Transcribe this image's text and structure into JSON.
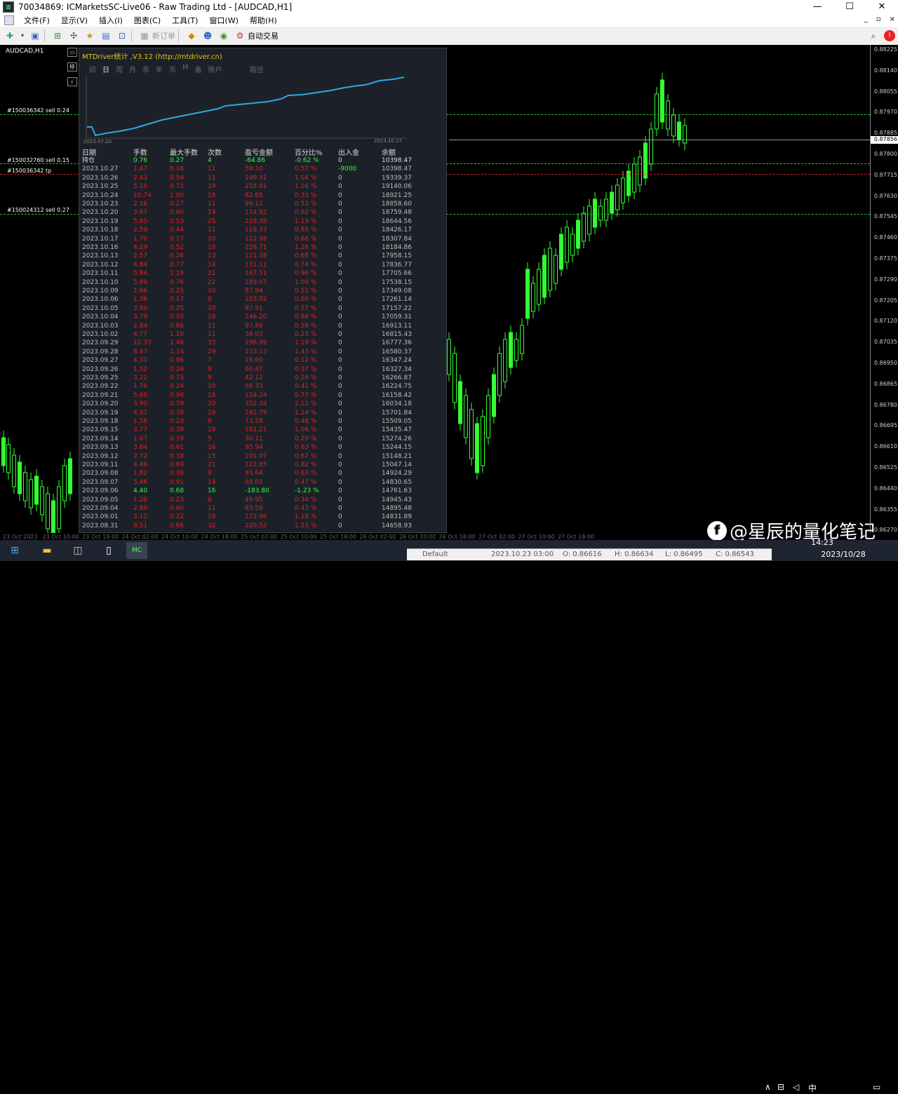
{
  "window": {
    "title": "70034869: ICMarketsSC-Live06 - Raw Trading Ltd - [AUDCAD,H1]",
    "controls": [
      "—",
      "☐",
      "✕"
    ]
  },
  "menu": [
    "文件(F)",
    "显示(V)",
    "插入(I)",
    "图表(C)",
    "工具(T)",
    "窗口(W)",
    "帮助(H)"
  ],
  "mdi_controls": [
    "_",
    "▫",
    "×"
  ],
  "toolbar": {
    "new_order": "新订单",
    "auto_trading": "自动交易",
    "search_icon": "search-icon",
    "notify_icon": "alert-icon"
  },
  "chart": {
    "symbol": "AUDCAD,H1",
    "up_color": "#33ff33",
    "bg_color": "#000000",
    "current_price": "0.87856",
    "price_ticks": [
      "0.88225",
      "0.88140",
      "0.88055",
      "0.87970",
      "0.87885",
      "0.87800",
      "0.87715",
      "0.87630",
      "0.87545",
      "0.87460",
      "0.87375",
      "0.87290",
      "0.87205",
      "0.87120",
      "0.87035",
      "0.86950",
      "0.86865",
      "0.86780",
      "0.86695",
      "0.86610",
      "0.86525",
      "0.86440",
      "0.86355",
      "0.86270"
    ],
    "time_ticks": [
      "23 Oct 2023",
      "23 Oct 10:00",
      "23 Oct 18:00",
      "24 Oct 02:00",
      "24 Oct 10:00",
      "24 Oct 18:00",
      "25 Oct 02:00",
      "25 Oct 10:00",
      "25 Oct 18:00",
      "26 Oct 02:00",
      "26 Oct 10:00",
      "26 Oct 18:00",
      "27 Oct 02:00",
      "27 Oct 10:00",
      "27 Oct 18:00"
    ],
    "orders": [
      {
        "label": "#150036342 sell 0.24",
        "color": "green"
      },
      {
        "label": "#150032760 sell 0.15",
        "color": "green"
      },
      {
        "label": "#150036342 tp",
        "color": "red"
      },
      {
        "label": "#150024312 sell 0.27",
        "color": "green"
      }
    ]
  },
  "left_strip": [
    "▭",
    "移",
    "√"
  ],
  "panel": {
    "title": "MTDriver统计 ,V3.12 (http://mtdriver.cn)",
    "tabs": [
      "综",
      "日",
      "周",
      "月",
      "季",
      "年",
      "币",
      "M",
      "备",
      "账户",
      "路径"
    ],
    "active_tab": "日",
    "mini_chart": {
      "start_label": "2023.07.20",
      "end_label": "2023.10.27",
      "line_color": "#2ea8e0"
    },
    "headers": [
      "日期",
      "手数",
      "最大手数",
      "次数",
      "盈亏金额",
      "百分比%",
      "出入金",
      "余额"
    ],
    "holding": [
      "持仓",
      "0.76",
      "0.27",
      "4",
      "-64.86",
      "-0.62 %",
      "0",
      "10398.47"
    ],
    "rows": [
      [
        "2023.10.27",
        "1.47",
        "0.18",
        "11",
        "59.10",
        "0.57 %",
        "-9000",
        "10398.47"
      ],
      [
        "2023.10.26",
        "2.43",
        "0.54",
        "11",
        "199.31",
        "1.04 %",
        "0",
        "19339.37"
      ],
      [
        "2023.10.25",
        "5.10",
        "0.71",
        "19",
        "218.81",
        "1.16 %",
        "0",
        "19140.06"
      ],
      [
        "2023.10.24",
        "10.74",
        "1.60",
        "18",
        "62.65",
        "0.33 %",
        "0",
        "18921.25"
      ],
      [
        "2023.10.23",
        "2.16",
        "0.27",
        "11",
        "99.12",
        "0.53 %",
        "0",
        "18858.60"
      ],
      [
        "2023.10.20",
        "3.67",
        "0.60",
        "14",
        "114.92",
        "0.62 %",
        "0",
        "18759.48"
      ],
      [
        "2023.10.19",
        "5.85",
        "0.53",
        "25",
        "218.39",
        "1.19 %",
        "0",
        "18644.56"
      ],
      [
        "2023.10.18",
        "2.59",
        "0.44",
        "11",
        "118.33",
        "0.65 %",
        "0",
        "18426.17"
      ],
      [
        "2023.10.17",
        "1.70",
        "0.17",
        "10",
        "122.98",
        "0.68 %",
        "0",
        "18307.84"
      ],
      [
        "2023.10.16",
        "4.29",
        "0.52",
        "19",
        "226.71",
        "1.26 %",
        "0",
        "18184.86"
      ],
      [
        "2023.10.13",
        "2.57",
        "0.26",
        "13",
        "121.38",
        "0.68 %",
        "0",
        "17958.15"
      ],
      [
        "2023.10.12",
        "4.84",
        "0.77",
        "14",
        "131.11",
        "0.74 %",
        "0",
        "17836.77"
      ],
      [
        "2023.10.11",
        "5.84",
        "1.19",
        "21",
        "167.51",
        "0.96 %",
        "0",
        "17705.66"
      ],
      [
        "2023.10.10",
        "5.89",
        "0.76",
        "22",
        "189.07",
        "1.09 %",
        "0",
        "17538.15"
      ],
      [
        "2023.10.09",
        "1.66",
        "0.25",
        "10",
        "87.94",
        "0.51 %",
        "0",
        "17349.08"
      ],
      [
        "2023.10.06",
        "1.36",
        "0.17",
        "8",
        "103.92",
        "0.60 %",
        "0",
        "17261.14"
      ],
      [
        "2023.10.05",
        "3.80",
        "0.25",
        "20",
        "97.91",
        "0.57 %",
        "0",
        "17157.22"
      ],
      [
        "2023.10.04",
        "3.79",
        "0.50",
        "18",
        "146.20",
        "0.86 %",
        "0",
        "17059.31"
      ],
      [
        "2023.10.03",
        "2.84",
        "0.66",
        "11",
        "97.88",
        "0.58 %",
        "0",
        "16913.11"
      ],
      [
        "2023.10.02",
        "4.77",
        "1.16",
        "11",
        "38.07",
        "0.23 %",
        "0",
        "16815.43"
      ],
      [
        "2023.09.29",
        "12.33",
        "1.46",
        "33",
        "196.99",
        "1.19 %",
        "0",
        "16777.36"
      ],
      [
        "2023.09.28",
        "8.47",
        "1.14",
        "29",
        "233.13",
        "1.43 %",
        "0",
        "16580.37"
      ],
      [
        "2023.09.27",
        "4.31",
        "0.96",
        "7",
        "19.60",
        "0.12 %",
        "0",
        "16347.24"
      ],
      [
        "2023.09.26",
        "1.52",
        "0.24",
        "9",
        "60.47",
        "0.37 %",
        "0",
        "16327.34"
      ],
      [
        "2023.09.25",
        "3.22",
        "0.73",
        "9",
        "42.12",
        "0.26 %",
        "0",
        "16266.87"
      ],
      [
        "2023.09.22",
        "1.76",
        "0.24",
        "10",
        "68.33",
        "0.41 %",
        "0",
        "16224.75"
      ],
      [
        "2023.09.21",
        "5.60",
        "0.96",
        "18",
        "124.24",
        "0.77 %",
        "0",
        "16158.42"
      ],
      [
        "2023.09.20",
        "3.90",
        "0.39",
        "20",
        "332.34",
        "2.12 %",
        "0",
        "16034.18"
      ],
      [
        "2023.09.19",
        "4.07",
        "0.39",
        "19",
        "192.79",
        "1.24 %",
        "0",
        "15701.84"
      ],
      [
        "2023.09.18",
        "1.58",
        "0.23",
        "9",
        "73.58",
        "0.48 %",
        "0",
        "15509.05"
      ],
      [
        "2023.09.15",
        "3.77",
        "0.39",
        "18",
        "161.21",
        "1.06 %",
        "0",
        "15435.47"
      ],
      [
        "2023.09.14",
        "1.07",
        "0.39",
        "5",
        "30.11",
        "0.20 %",
        "0",
        "15274.26"
      ],
      [
        "2023.09.13",
        "3.64",
        "0.61",
        "16",
        "95.94",
        "0.63 %",
        "0",
        "15244.15"
      ],
      [
        "2023.09.12",
        "2.72",
        "0.38",
        "15",
        "101.07",
        "0.67 %",
        "0",
        "15148.21"
      ],
      [
        "2023.09.11",
        "4.48",
        "0.69",
        "21",
        "122.85",
        "0.82 %",
        "0",
        "15047.14"
      ],
      [
        "2023.09.08",
        "1.82",
        "0.38",
        "9",
        "93.64",
        "0.63 %",
        "0",
        "14924.29"
      ],
      [
        "2023.09.07",
        "5.46",
        "0.91",
        "14",
        "69.02",
        "0.47 %",
        "0",
        "14830.65"
      ],
      [
        "2023.09.06",
        "4.40",
        "0.68",
        "16",
        "-183.80",
        "-1.23 %",
        "0",
        "14761.63"
      ],
      [
        "2023.09.05",
        "1.28",
        "0.23",
        "8",
        "49.95",
        "0.34 %",
        "0",
        "14945.43"
      ],
      [
        "2023.09.04",
        "2.80",
        "0.60",
        "11",
        "63.59",
        "0.43 %",
        "0",
        "14895.48"
      ],
      [
        "2023.09.01",
        "3.12",
        "0.22",
        "18",
        "172.96",
        "1.18 %",
        "0",
        "14831.89"
      ],
      [
        "2023.08.31",
        "8.51",
        "0.66",
        "32",
        "220.52",
        "1.53 %",
        "0",
        "14658.93"
      ]
    ]
  },
  "status_bar": {
    "profile": "Default",
    "time": "2023.10.23 03:00",
    "open": "O: 0.86616",
    "high": "H: 0.86634",
    "low": "L: 0.86495",
    "close": "C: 0.86543"
  },
  "taskbar": {
    "clock_time": "14:23",
    "clock_date": "2023/10/28",
    "ime": "中",
    "app_label": "MC"
  },
  "watermark": "@星辰的量化笔记"
}
